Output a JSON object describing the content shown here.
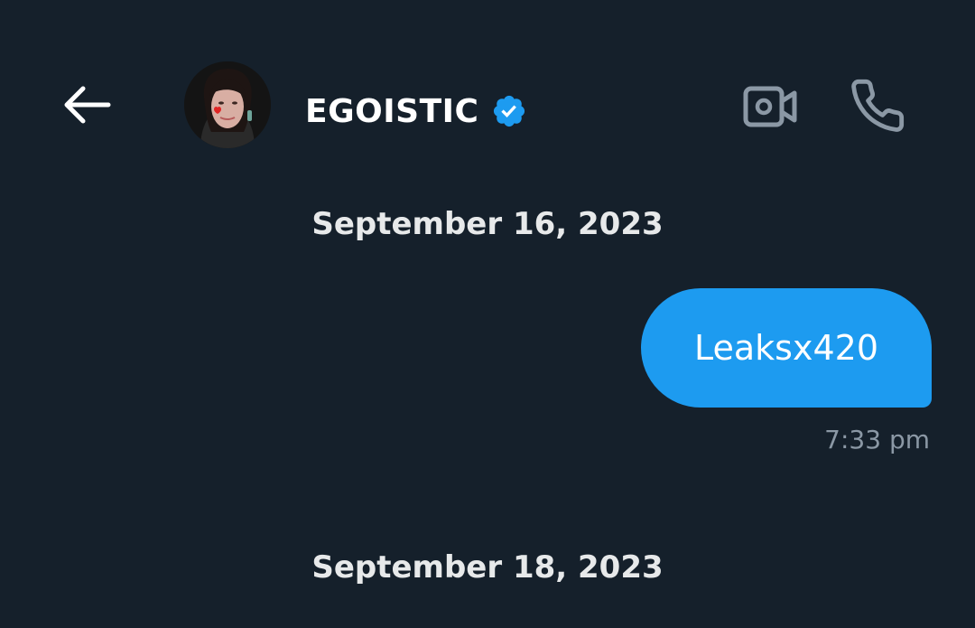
{
  "header": {
    "title": "EGOISTIC",
    "verified": true,
    "icons": {
      "back": "arrow-left-icon",
      "verified": "verified-badge-icon",
      "video": "video-call-icon",
      "phone": "phone-call-icon"
    }
  },
  "colors": {
    "background": "#15202b",
    "accent": "#1d9bf0",
    "icon_muted": "#8b98a5",
    "text_primary": "#e7e9ea"
  },
  "conversation": {
    "groups": [
      {
        "date": "September 16, 2023",
        "messages": [
          {
            "direction": "sent",
            "text": "Leaksx420",
            "time": "7:33 pm"
          }
        ]
      },
      {
        "date": "September 18, 2023",
        "messages": []
      }
    ]
  }
}
